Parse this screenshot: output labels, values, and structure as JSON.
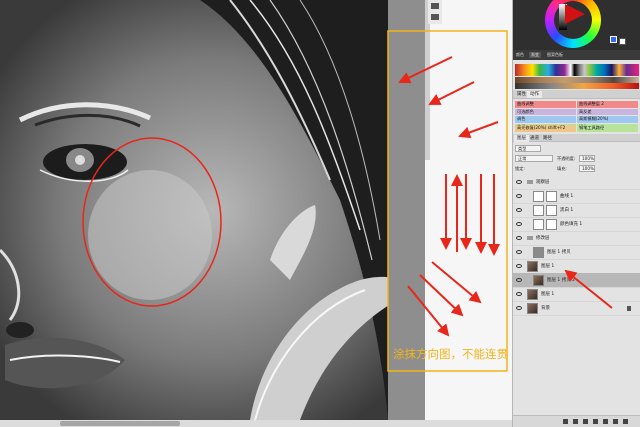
{
  "annotation": {
    "caption": "涂抹方向图，不能连贯",
    "caption_color": "#f3b41a",
    "box_color": "#f3b41a",
    "arrow_color": "#e8261a",
    "circle_color": "#e8261a"
  },
  "panel": {
    "swatch_tabs": [
      "颜色",
      "渐变",
      "图案色板"
    ],
    "props_tabs": [
      "属性",
      "动作"
    ],
    "actions": [
      {
        "label": "曲线调整",
        "color": "#f08a8a"
      },
      {
        "label": "曲线调整层 2",
        "color": "#f08a8a"
      },
      {
        "label": "可选颜色",
        "color": "#c9b4e0"
      },
      {
        "label": "高反差",
        "color": "#c9b4e0"
      },
      {
        "label": "调色",
        "color": "#9fc8f0"
      },
      {
        "label": "高斯模糊(20%)",
        "color": "#9fc8f0"
      },
      {
        "label": "曲线",
        "color": "#b7e39a"
      },
      {
        "label": "锐化",
        "color": "#b7e39a"
      },
      {
        "label": "高光修复(20%)",
        "color": "#f0c78a"
      },
      {
        "label": "shift+F2",
        "color": "#f08a8a"
      },
      {
        "label": "创建快照",
        "color": "#b7e39a"
      },
      {
        "label": "钢笔工具路径",
        "color": "#f0c78a"
      }
    ],
    "layers_tabs": [
      "图层",
      "通道",
      "路径"
    ],
    "filter": {
      "kind": "类型",
      "blend_mode": "正常",
      "opacity_label": "不透明度:",
      "opacity": "100%",
      "lock_label": "锁定:",
      "fill_label": "填充:",
      "fill": "100%"
    },
    "layers": [
      {
        "name": "观察层",
        "kind": "group"
      },
      {
        "name": "曲线 1",
        "kind": "adjust"
      },
      {
        "name": "黑白 1",
        "kind": "adjust"
      },
      {
        "name": "颜色填充 1",
        "kind": "adjust"
      },
      {
        "name": "修改层",
        "kind": "group"
      },
      {
        "name": "图层 1 拷贝",
        "kind": "gray"
      },
      {
        "name": "图层 1",
        "kind": "photo"
      },
      {
        "name": "图层 1 拷贝 2",
        "kind": "photo",
        "selected": true
      },
      {
        "name": "图层 1",
        "kind": "photo"
      },
      {
        "name": "背景",
        "kind": "photo"
      }
    ]
  }
}
